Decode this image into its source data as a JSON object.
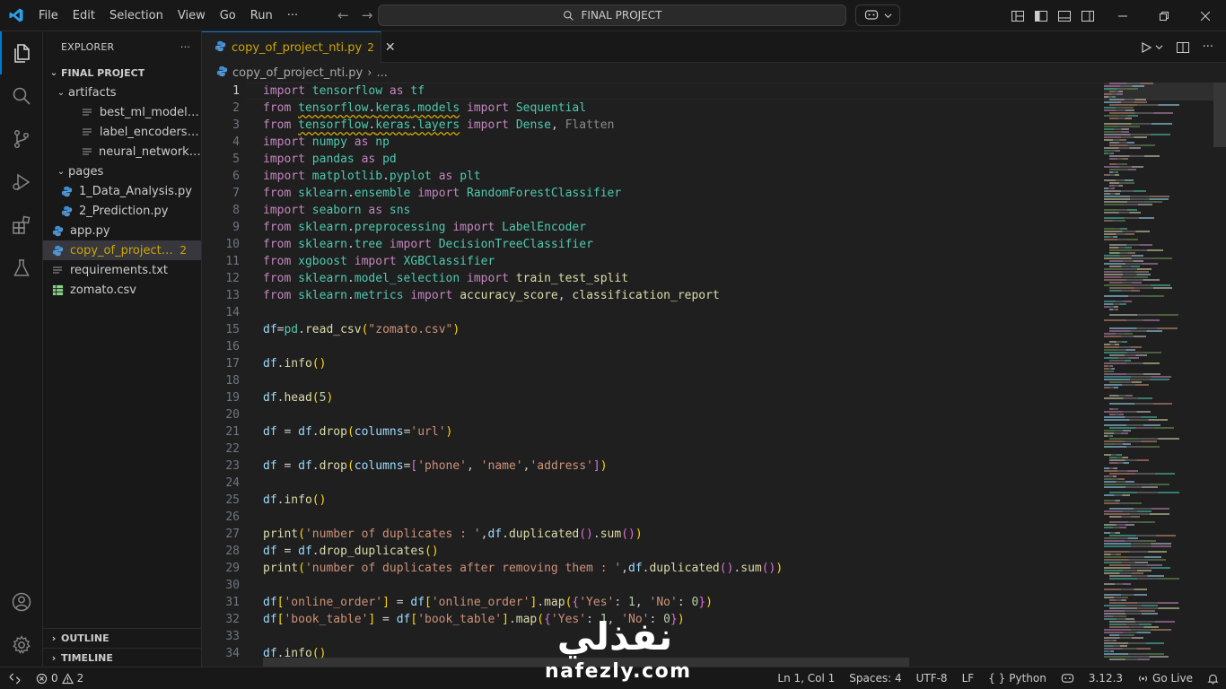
{
  "titlebar": {
    "menu": [
      "File",
      "Edit",
      "Selection",
      "View",
      "Go",
      "Run",
      "···"
    ],
    "search_text": "FINAL PROJECT"
  },
  "sidebar": {
    "title": "EXPLORER",
    "more": "···",
    "root": "FINAL PROJECT",
    "tree": [
      {
        "label": "artifacts",
        "type": "folder"
      },
      {
        "label": "best_ml_model.pkl",
        "type": "file"
      },
      {
        "label": "label_encoders.pkl",
        "type": "file"
      },
      {
        "label": "neural_network.keras",
        "type": "file"
      },
      {
        "label": "pages",
        "type": "folder"
      },
      {
        "label": "1_Data_Analysis.py",
        "type": "py"
      },
      {
        "label": "2_Prediction.py",
        "type": "py"
      },
      {
        "label": "app.py",
        "type": "py"
      },
      {
        "label": "copy_of_project_nti.py",
        "type": "py",
        "badge": "2"
      },
      {
        "label": "requirements.txt",
        "type": "txt"
      },
      {
        "label": "zomato.csv",
        "type": "csv"
      }
    ],
    "outline": "OUTLINE",
    "timeline": "TIMELINE"
  },
  "editor": {
    "tab_label": "copy_of_project_nti.py",
    "tab_badge": "2",
    "breadcrumb_file": "copy_of_project_nti.py",
    "breadcrumb_more": "...",
    "line_numbers": [
      "1",
      "2",
      "3",
      "4",
      "5",
      "6",
      "7",
      "8",
      "9",
      "10",
      "11",
      "12",
      "13",
      "14",
      "15",
      "16",
      "17",
      "18",
      "19",
      "20",
      "21",
      "22",
      "23",
      "24",
      "25",
      "26",
      "27",
      "28",
      "29",
      "30",
      "31",
      "32",
      "33",
      "34"
    ]
  },
  "status": {
    "errors": "0",
    "warnings": "2",
    "cursor": "Ln 1, Col 1",
    "spaces": "Spaces: 4",
    "encoding": "UTF-8",
    "eol": "LF",
    "language": "Python",
    "braces": "{ }",
    "python_version": "3.12.3",
    "go_live": "Go Live"
  },
  "watermark": {
    "arabic": "نفذلي",
    "url": "nafezly.com"
  },
  "colors": {
    "accent": "#0078d4",
    "warning": "#cca700",
    "keyword": "#c586c0",
    "module": "#4ec9b0",
    "function": "#dcdcaa",
    "string": "#ce9178"
  }
}
